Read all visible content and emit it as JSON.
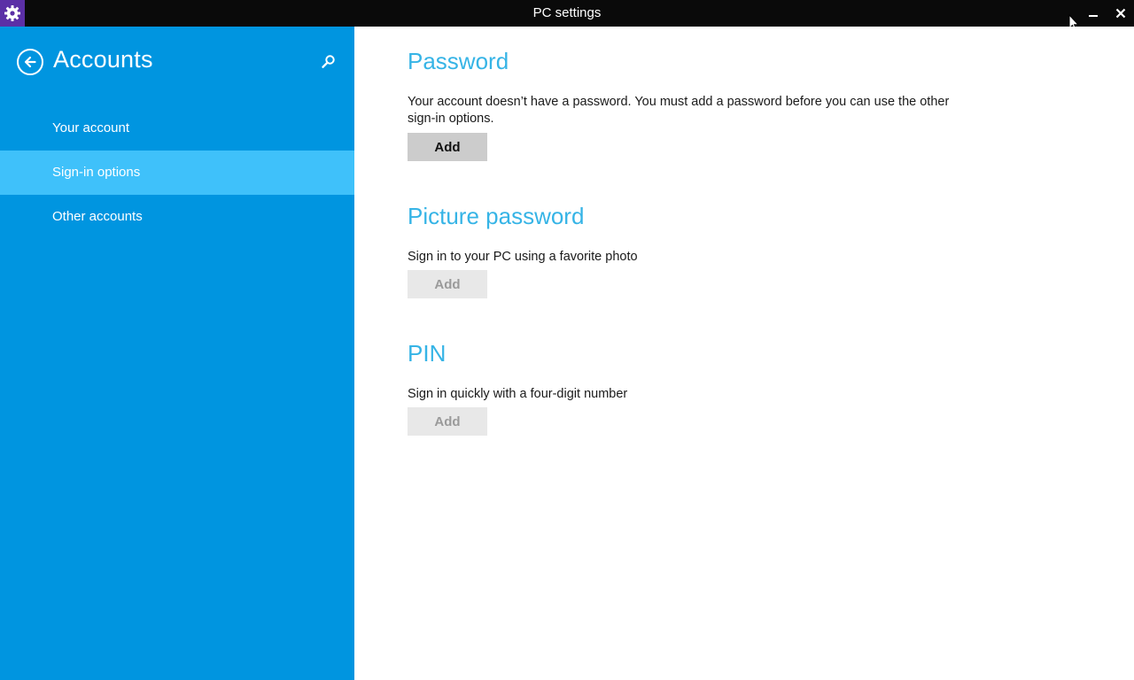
{
  "window": {
    "title": "PC settings",
    "app_icon": "gear-icon",
    "minimize_icon": "minimize-icon",
    "close_icon": "close-icon"
  },
  "sidebar": {
    "title": "Accounts",
    "back_icon": "back-arrow-icon",
    "search_icon": "search-icon",
    "background": "#0095e0",
    "selected_background": "#3fc1fa",
    "items": [
      {
        "label": "Your account",
        "selected": false
      },
      {
        "label": "Sign-in options",
        "selected": true
      },
      {
        "label": "Other accounts",
        "selected": false
      }
    ]
  },
  "main": {
    "accent": "#36b4e6",
    "sections": [
      {
        "title": "Password",
        "description": "Your account doesn’t have a password. You must add a password before you can use the other sign-in options.",
        "button_label": "Add",
        "button_enabled": true
      },
      {
        "title": "Picture password",
        "description": "Sign in to your PC using a favorite photo",
        "button_label": "Add",
        "button_enabled": false
      },
      {
        "title": "PIN",
        "description": "Sign in quickly with a four-digit number",
        "button_label": "Add",
        "button_enabled": false
      }
    ]
  }
}
